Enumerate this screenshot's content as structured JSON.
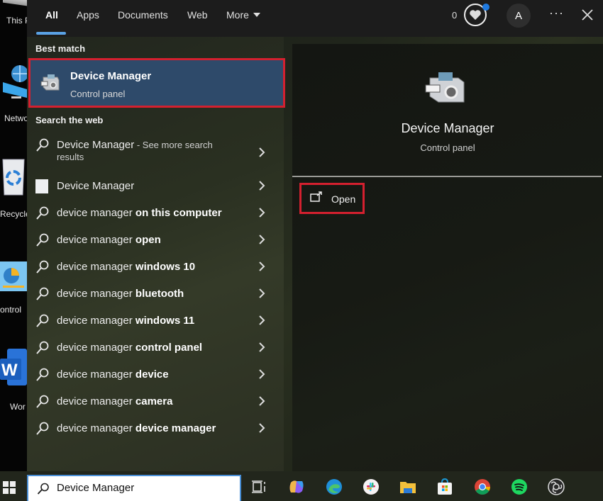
{
  "desktop": {
    "items": [
      {
        "label": "This P",
        "icon": "this-pc-icon"
      },
      {
        "label": "Netwo",
        "icon": "network-icon"
      },
      {
        "label": "Recycle",
        "icon": "recycle-bin-icon"
      },
      {
        "label": "ontrol",
        "icon": "control-panel-icon"
      },
      {
        "label": "Wor",
        "icon": "word-icon"
      }
    ]
  },
  "nav": {
    "tabs": [
      {
        "label": "All",
        "active": true
      },
      {
        "label": "Apps",
        "active": false
      },
      {
        "label": "Documents",
        "active": false
      },
      {
        "label": "Web",
        "active": false
      },
      {
        "label": "More",
        "active": false
      }
    ],
    "points": "0",
    "avatar_initial": "A",
    "more_options": "···"
  },
  "best_match": {
    "header": "Best match",
    "title": "Device Manager",
    "subtitle": "Control panel"
  },
  "search_web": {
    "header": "Search the web",
    "items": [
      {
        "icon": "search-icon",
        "prefix": "Device Manager",
        "bold": "",
        "suffix": " - See more search",
        "line2": "results"
      },
      {
        "icon": "website-thumbnail-icon",
        "prefix": "Device Manager",
        "bold": "",
        "suffix": "",
        "line2": ""
      },
      {
        "icon": "search-icon",
        "prefix": "device manager ",
        "bold": "on this computer",
        "suffix": "",
        "line2": ""
      },
      {
        "icon": "search-icon",
        "prefix": "device manager ",
        "bold": "open",
        "suffix": "",
        "line2": ""
      },
      {
        "icon": "search-icon",
        "prefix": "device manager ",
        "bold": "windows 10",
        "suffix": "",
        "line2": ""
      },
      {
        "icon": "search-icon",
        "prefix": "device manager ",
        "bold": "bluetooth",
        "suffix": "",
        "line2": ""
      },
      {
        "icon": "search-icon",
        "prefix": "device manager ",
        "bold": "windows 11",
        "suffix": "",
        "line2": ""
      },
      {
        "icon": "search-icon",
        "prefix": "device manager ",
        "bold": "control panel",
        "suffix": "",
        "line2": ""
      },
      {
        "icon": "search-icon",
        "prefix": "device manager ",
        "bold": "device",
        "suffix": "",
        "line2": ""
      },
      {
        "icon": "search-icon",
        "prefix": "device manager ",
        "bold": "camera",
        "suffix": "",
        "line2": ""
      },
      {
        "icon": "search-icon",
        "prefix": "device manager ",
        "bold": "device manager",
        "suffix": "",
        "line2": ""
      }
    ]
  },
  "detail": {
    "title": "Device Manager",
    "subtitle": "Control panel",
    "actions": [
      {
        "label": "Open",
        "icon": "open-external-icon"
      }
    ]
  },
  "taskbar": {
    "search_value": "Device Manager",
    "apps": [
      "task-view",
      "copilot",
      "edge",
      "slack",
      "file-explorer",
      "microsoft-store",
      "chrome",
      "spotify",
      "obs-studio"
    ]
  },
  "colors": {
    "accent": "#5aa2e6",
    "best_match_bg": "#2e4a6a",
    "highlight_border": "#d4202f",
    "notification_dot": "#1f7ae0"
  }
}
